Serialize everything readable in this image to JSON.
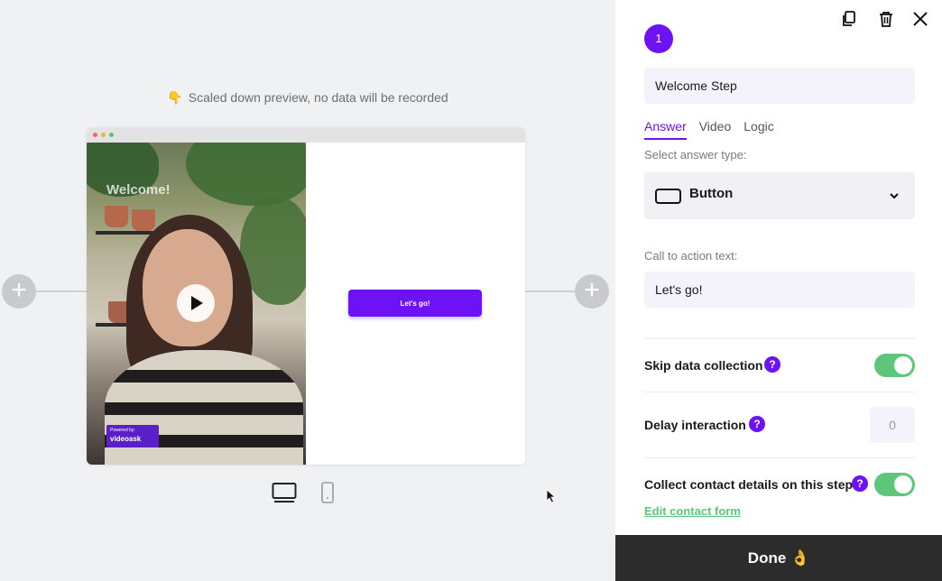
{
  "canvas": {
    "preview_note": "Scaled down preview, no data will be recorded",
    "preview_note_emoji": "👇",
    "video_overlay_text": "Welcome!",
    "powered_by_small": "Powered by:",
    "powered_by_brand": "videoask",
    "cta_button_label": "Let's go!",
    "add_left": "+",
    "add_right": "+"
  },
  "panel": {
    "step_number": "1",
    "step_title": "Welcome Step",
    "tabs": [
      {
        "label": "Answer",
        "active": true
      },
      {
        "label": "Video",
        "active": false
      },
      {
        "label": "Logic",
        "active": false
      }
    ],
    "answer_type_label": "Select answer type:",
    "answer_type_value": "Button",
    "cta_text_label": "Call to action text:",
    "cta_text_value": "Let's go!",
    "skip_data_label": "Skip data collection",
    "skip_data_on": true,
    "delay_label": "Delay interaction",
    "delay_value": "0",
    "collect_label": "Collect contact details on this step",
    "collect_on": true,
    "edit_contact_link": "Edit contact form",
    "help_glyph": "?",
    "done_label": "Done 👌"
  },
  "colors": {
    "accent": "#6d12f5",
    "toggle_on": "#5cc77a",
    "done_bg": "#2c2c2c"
  }
}
